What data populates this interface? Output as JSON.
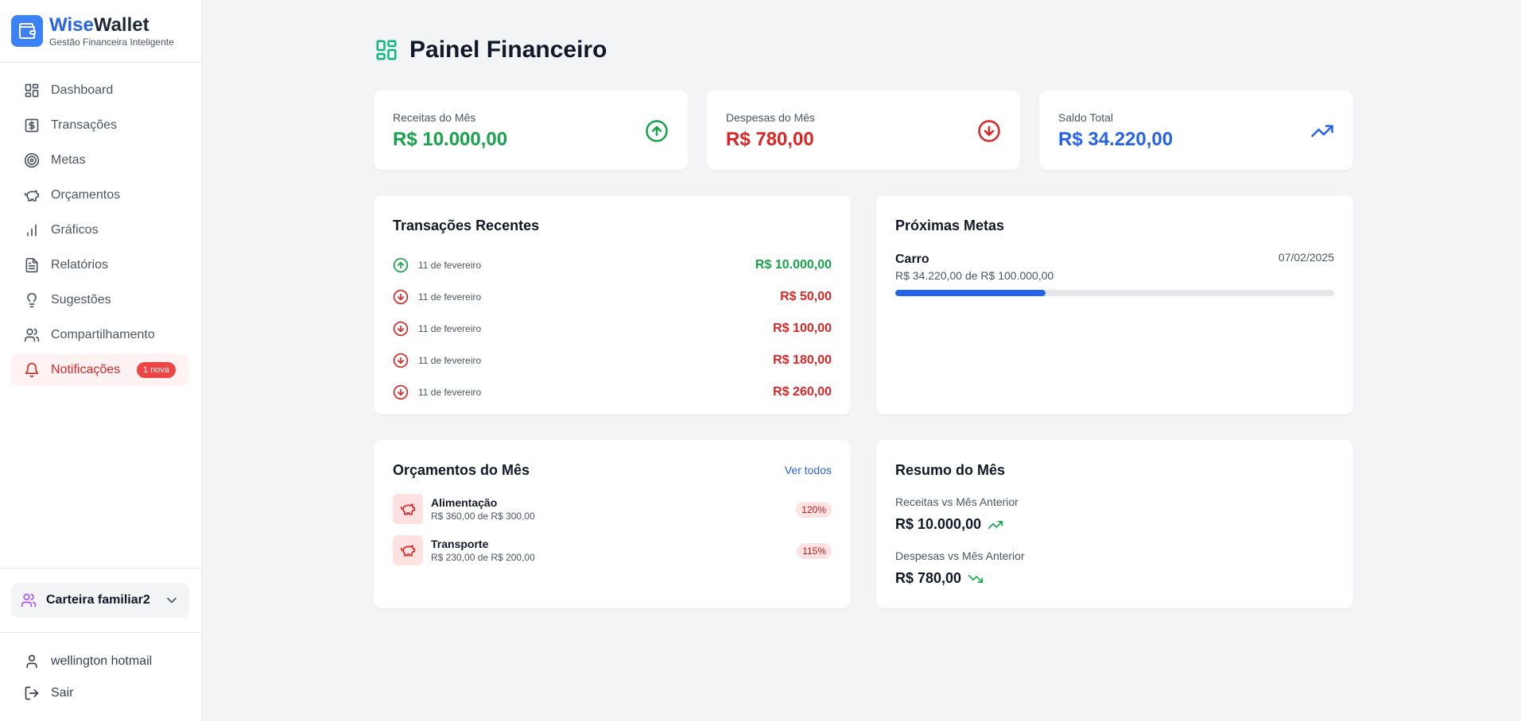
{
  "brand": {
    "name_part1": "Wise",
    "name_part2": "Wallet",
    "tagline": "Gestão Financeira Inteligente"
  },
  "sidebar": {
    "items": [
      {
        "label": "Dashboard",
        "icon": "dashboard-icon"
      },
      {
        "label": "Transações",
        "icon": "dollar-icon"
      },
      {
        "label": "Metas",
        "icon": "target-icon"
      },
      {
        "label": "Orçamentos",
        "icon": "piggy-bank-icon"
      },
      {
        "label": "Gráficos",
        "icon": "bar-chart-icon"
      },
      {
        "label": "Relatórios",
        "icon": "file-text-icon"
      },
      {
        "label": "Sugestões",
        "icon": "lightbulb-icon"
      },
      {
        "label": "Compartilhamento",
        "icon": "users-icon"
      },
      {
        "label": "Notificações",
        "icon": "bell-icon",
        "badge": "1 nova",
        "active": true
      }
    ],
    "wallet_selector": "Carteira familiar2",
    "user_name": "wellington hotmail",
    "logout_label": "Sair"
  },
  "page": {
    "title": "Painel Financeiro"
  },
  "stats": [
    {
      "label": "Receitas do Mês",
      "value": "R$ 10.000,00",
      "color": "#16a34a",
      "icon": "arrow-up-circle-icon"
    },
    {
      "label": "Despesas do Mês",
      "value": "R$ 780,00",
      "color": "#dc2626",
      "icon": "arrow-down-circle-icon"
    },
    {
      "label": "Saldo Total",
      "value": "R$ 34.220,00",
      "color": "#2563eb",
      "icon": "trending-up-icon"
    }
  ],
  "recent": {
    "title": "Transações Recentes",
    "rows": [
      {
        "date": "11 de fevereiro",
        "amount": "R$ 10.000,00",
        "type": "income"
      },
      {
        "date": "11 de fevereiro",
        "amount": "R$ 50,00",
        "type": "expense"
      },
      {
        "date": "11 de fevereiro",
        "amount": "R$ 100,00",
        "type": "expense"
      },
      {
        "date": "11 de fevereiro",
        "amount": "R$ 180,00",
        "type": "expense"
      },
      {
        "date": "11 de fevereiro",
        "amount": "R$ 260,00",
        "type": "expense"
      }
    ]
  },
  "goals": {
    "title": "Próximas Metas",
    "items": [
      {
        "name": "Carro",
        "date": "07/02/2025",
        "progress_text": "R$ 34.220,00 de R$ 100.000,00",
        "progress_pct": 34.22
      }
    ]
  },
  "budgets": {
    "title": "Orçamentos do Mês",
    "link": "Ver todos",
    "items": [
      {
        "name": "Alimentação",
        "detail": "R$ 360,00 de R$ 300,00",
        "pct": "120%"
      },
      {
        "name": "Transporte",
        "detail": "R$ 230,00 de R$ 200,00",
        "pct": "115%"
      }
    ]
  },
  "summary": {
    "title": "Resumo do Mês",
    "income_label": "Receitas vs Mês Anterior",
    "income_value": "R$ 10.000,00",
    "expense_label": "Despesas vs Mês Anterior",
    "expense_value": "R$ 780,00"
  },
  "colors": {
    "income": "#16a34a",
    "expense": "#dc2626",
    "accent": "#2563eb"
  }
}
